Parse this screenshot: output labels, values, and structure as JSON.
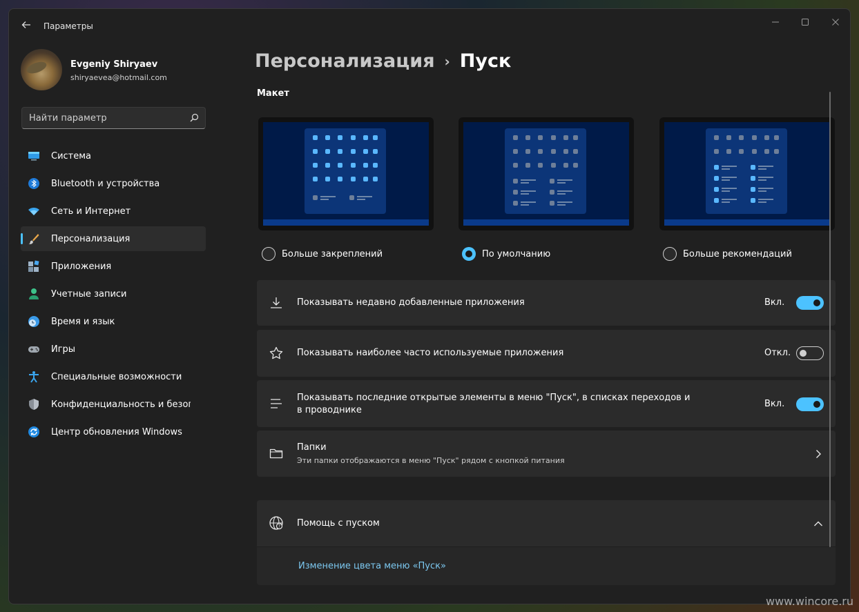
{
  "app_title": "Параметры",
  "user": {
    "name": "Evgeniy Shiryaev",
    "email": "shiryaevea@hotmail.com"
  },
  "search": {
    "placeholder": "Найти параметр"
  },
  "nav": [
    {
      "label": "Система",
      "icon": "monitor-icon"
    },
    {
      "label": "Bluetooth и устройства",
      "icon": "bluetooth-icon"
    },
    {
      "label": "Сеть и Интернет",
      "icon": "wifi-icon"
    },
    {
      "label": "Персонализация",
      "icon": "brush-icon",
      "active": true
    },
    {
      "label": "Приложения",
      "icon": "apps-icon"
    },
    {
      "label": "Учетные записи",
      "icon": "person-icon"
    },
    {
      "label": "Время и язык",
      "icon": "clock-globe-icon"
    },
    {
      "label": "Игры",
      "icon": "gamepad-icon"
    },
    {
      "label": "Специальные возможности",
      "icon": "accessibility-icon"
    },
    {
      "label": "Конфиденциальность и безопасность",
      "icon": "shield-icon"
    },
    {
      "label": "Центр обновления Windows",
      "icon": "update-icon"
    }
  ],
  "breadcrumb": {
    "parent": "Персонализация",
    "separator": "›",
    "current": "Пуск"
  },
  "layout": {
    "title": "Макет",
    "options": [
      {
        "label": "Больше закреплений",
        "checked": false
      },
      {
        "label": "По умолчанию",
        "checked": true
      },
      {
        "label": "Больше рекомендаций",
        "checked": false
      }
    ]
  },
  "settings": {
    "recent_apps": {
      "label": "Показывать недавно добавленные приложения",
      "state": "Вкл.",
      "on": true
    },
    "most_used": {
      "label": "Показывать наиболее часто используемые приложения",
      "state": "Откл.",
      "on": false
    },
    "recent_items": {
      "label": "Показывать последние открытые элементы в меню \"Пуск\", в списках переходов и в проводнике",
      "state": "Вкл.",
      "on": true
    },
    "folders": {
      "label": "Папки",
      "sub": "Эти папки отображаются в меню \"Пуск\" рядом с кнопкой питания"
    }
  },
  "help": {
    "title": "Помощь с пуском",
    "link": "Изменение цвета меню «Пуск»"
  },
  "watermark": "www.wincore.ru",
  "colors": {
    "accent": "#4cc2ff",
    "background": "#202020",
    "card": "#2b2b2b",
    "link": "#7cc8f0"
  }
}
